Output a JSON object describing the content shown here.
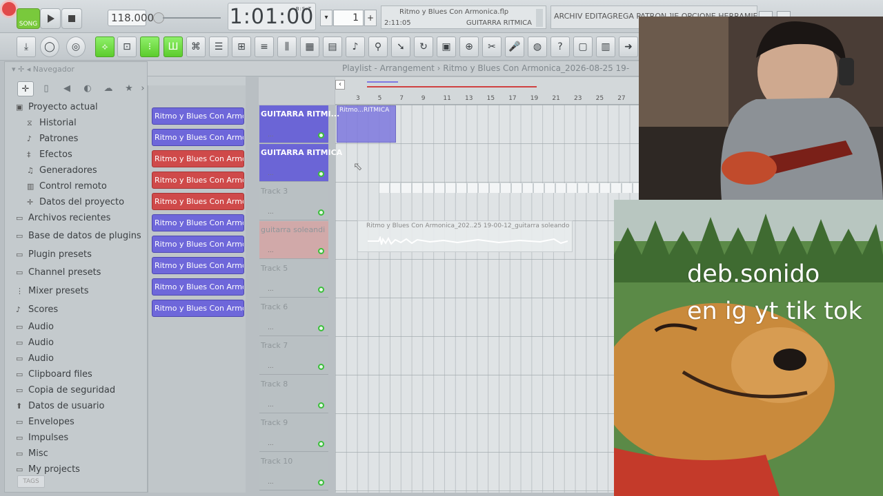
{
  "transport": {
    "song_label": "SONG",
    "tempo": "118.000",
    "time": "1:01:00",
    "time_unit": "B:S:T",
    "pattern_number": "1"
  },
  "project": {
    "file_name": "Ritmo y Blues Con Armonica.flp",
    "time": "2:11:05",
    "track": "GUITARRA RITMICA"
  },
  "menu_hint": "ARCHIV EDITAGREGA PATRON ]IE OPCIONE HERRAMIENTA",
  "browser": {
    "title": "Navegador",
    "items": [
      {
        "label": "Proyecto actual",
        "icon": "▣"
      },
      {
        "label": "Historial",
        "icon": "⧖"
      },
      {
        "label": "Patrones",
        "icon": "♪"
      },
      {
        "label": "Efectos",
        "icon": "‡"
      },
      {
        "label": "Generadores",
        "icon": "♫"
      },
      {
        "label": "Control remoto",
        "icon": "▥"
      },
      {
        "label": "Datos del proyecto",
        "icon": "✛"
      },
      {
        "label": "Archivos recientes",
        "icon": "▭"
      },
      {
        "label": "Base de datos de plugins",
        "icon": "▭"
      },
      {
        "label": "Plugin presets",
        "icon": "▭"
      },
      {
        "label": "Channel presets",
        "icon": "▭"
      },
      {
        "label": "Mixer presets",
        "icon": "⋮"
      },
      {
        "label": "Scores",
        "icon": "♪"
      },
      {
        "label": "Audio",
        "icon": "▭"
      },
      {
        "label": "Audio",
        "icon": "▭"
      },
      {
        "label": "Audio",
        "icon": "▭"
      },
      {
        "label": "Clipboard files",
        "icon": "▭"
      },
      {
        "label": "Copia de seguridad",
        "icon": "▭"
      },
      {
        "label": "Datos de usuario",
        "icon": "⬆"
      },
      {
        "label": "Envelopes",
        "icon": "▭"
      },
      {
        "label": "Impulses",
        "icon": "▭"
      },
      {
        "label": "Misc",
        "icon": "▭"
      },
      {
        "label": "My projects",
        "icon": "▭"
      }
    ],
    "tags_label": "TAGS"
  },
  "clips": [
    {
      "label": "Ritmo y Blues Con Armon...",
      "color": "blue"
    },
    {
      "label": "Ritmo y Blues Con Armon...",
      "color": "blue"
    },
    {
      "label": "Ritmo y Blues Con Armon...",
      "color": "red"
    },
    {
      "label": "Ritmo y Blues Con Armon...",
      "color": "red"
    },
    {
      "label": "Ritmo y Blues Con Armon...",
      "color": "red"
    },
    {
      "label": "Ritmo y Blues Con Armon...",
      "color": "blue"
    },
    {
      "label": "Ritmo y Blues Con Armon...",
      "color": "blue"
    },
    {
      "label": "Ritmo y Blues Con Armon...",
      "color": "blue"
    },
    {
      "label": "Ritmo y Blues Con Armon...",
      "color": "blue"
    },
    {
      "label": "Ritmo y Blues Con Armon...",
      "color": "blue"
    }
  ],
  "playlist": {
    "title": "Playlist - Arrangement › Ritmo y Blues Con Armonica_2026-08-25 19-",
    "ruler_ticks": [
      "3",
      "5",
      "7",
      "9",
      "11",
      "13",
      "15",
      "17",
      "19",
      "21",
      "23",
      "25",
      "27"
    ],
    "tracks": [
      {
        "name": "GUITARRA RITMI..."
      },
      {
        "name": "GUITARRA RITMICA"
      },
      {
        "name": "Track 3"
      },
      {
        "name": "guitarra soleandi"
      },
      {
        "name": "Track 5"
      },
      {
        "name": "Track 6"
      },
      {
        "name": "Track 7"
      },
      {
        "name": "Track 8"
      },
      {
        "name": "Track 9"
      },
      {
        "name": "Track 10"
      }
    ],
    "clip_ritmo": "Ritmo...RITMICA",
    "clip_solo": "Ritmo y Blues Con Armonica_202..25 19-00-12_guitarra soleando"
  },
  "overlay": {
    "line1": "deb.sonido",
    "line2": "en ig yt tik tok"
  },
  "colors": {
    "accent_green": "#5ccc2c",
    "clip_blue": "#6e67da",
    "clip_red": "#cf4a4a",
    "record_red": "#e04a4a"
  }
}
